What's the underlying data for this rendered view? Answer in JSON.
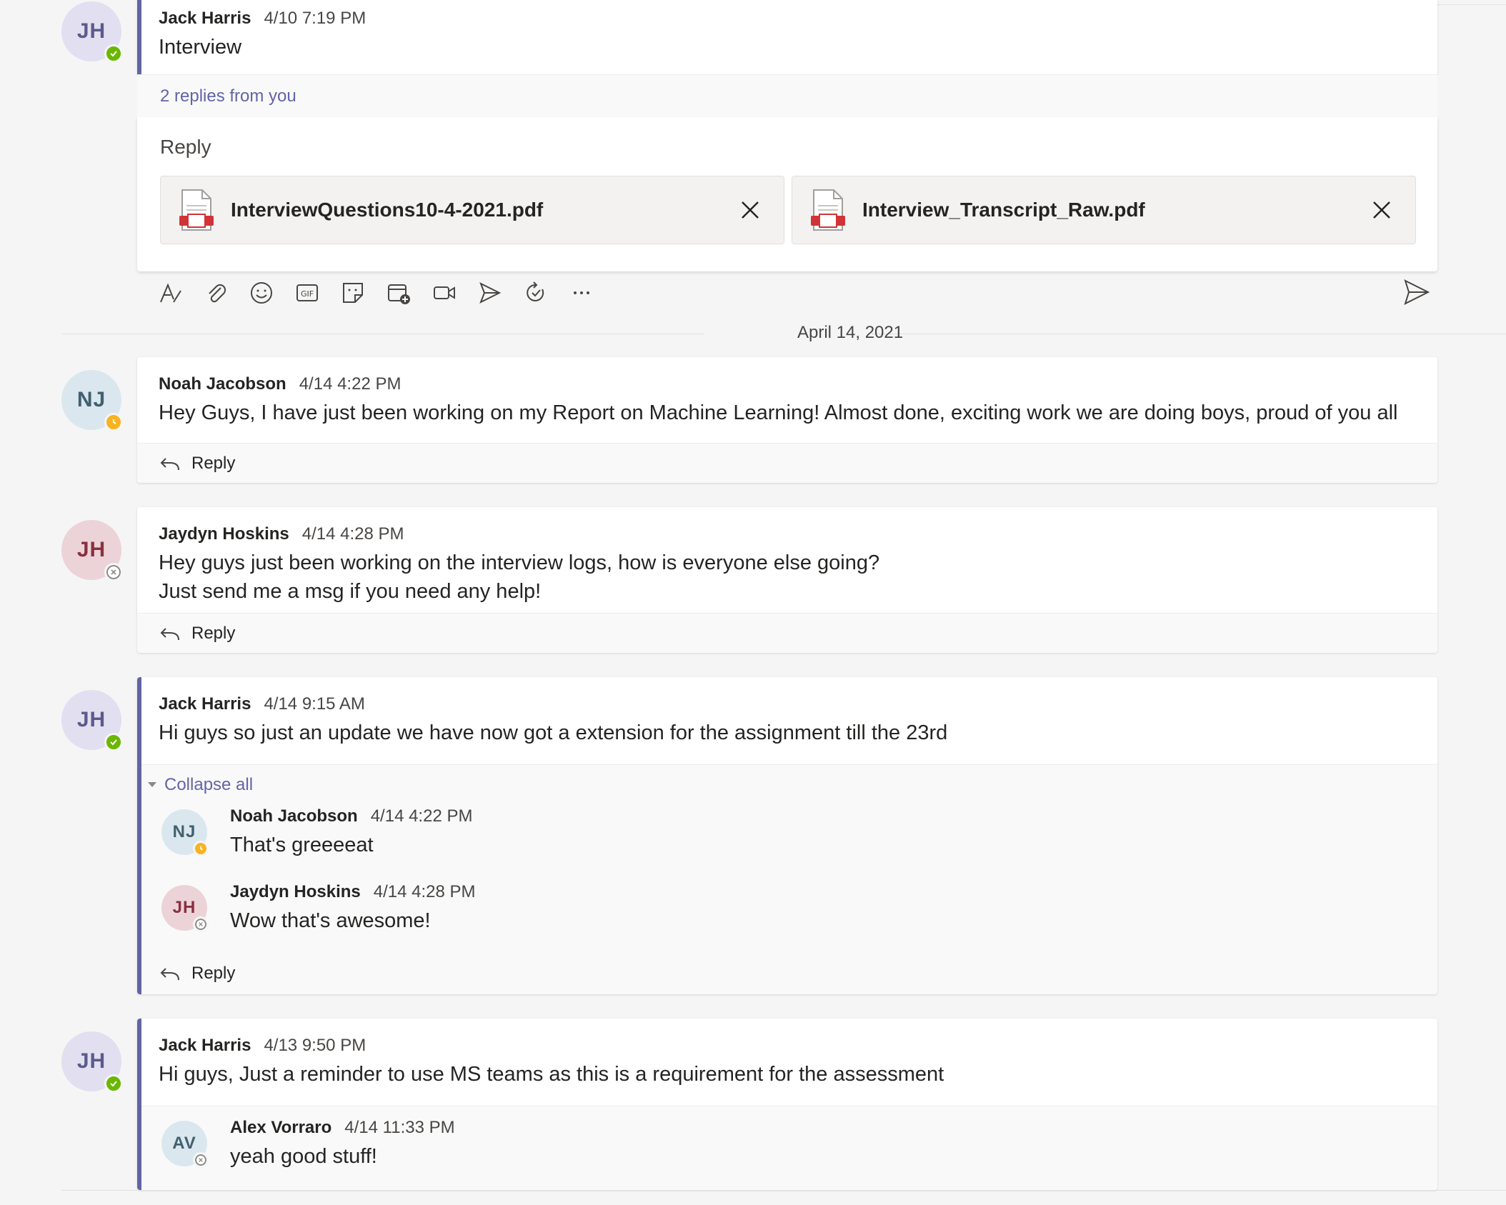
{
  "thread1": {
    "author": "Jack Harris",
    "time": "4/10 7:19 PM",
    "body": "Interview",
    "replies_link": "2 replies from you",
    "avatar": "JH"
  },
  "compose": {
    "label": "Reply",
    "files": [
      {
        "name": "InterviewQuestions10-4-2021.pdf"
      },
      {
        "name": "Interview_Transcript_Raw.pdf"
      }
    ],
    "toolbar": [
      "format-icon",
      "attach-icon",
      "emoji-icon",
      "gif-icon",
      "sticker-icon",
      "schedule-meeting-icon",
      "meet-now-icon",
      "praise-icon",
      "loop-icon",
      "more-options-icon"
    ]
  },
  "date_divider": "April 14, 2021",
  "messages": [
    {
      "author": "Noah Jacobson",
      "time": "4/14 4:22 PM",
      "body": "Hey Guys, I have just been working on my Report on Machine Learning! Almost done, exciting work we are doing boys, proud of you all",
      "avatar": "NJ",
      "reply_label": "Reply"
    },
    {
      "author": "Jaydyn Hoskins",
      "time": "4/14 4:28 PM",
      "body_line1": "Hey guys just been working on the interview logs, how is everyone else going?",
      "body_line2": "Just send me a msg if you need any help!",
      "avatar": "JH",
      "reply_label": "Reply"
    },
    {
      "author": "Jack Harris",
      "time": "4/14 9:15 AM",
      "body": "Hi guys so just an update we have now got a extension for the assignment till the 23rd",
      "avatar": "JH",
      "collapse_label": "Collapse all",
      "replies": [
        {
          "author": "Noah Jacobson",
          "time": "4/14 4:22 PM",
          "body": "That's greeeeat",
          "avatar": "NJ"
        },
        {
          "author": "Jaydyn Hoskins",
          "time": "4/14 4:28 PM",
          "body": "Wow that's awesome!",
          "avatar": "JH"
        }
      ],
      "reply_label": "Reply"
    },
    {
      "author": "Jack Harris",
      "time": "4/13 9:50 PM",
      "body": "Hi guys, Just a reminder to use MS teams as this is a requirement for the assessment",
      "avatar": "JH",
      "replies": [
        {
          "author": "Alex Vorraro",
          "time": "4/14 11:33 PM",
          "body": "yeah good stuff!",
          "avatar": "AV"
        }
      ]
    }
  ],
  "colors": {
    "accent": "#6264a7",
    "available": "#6bb700",
    "away": "#f8b321"
  }
}
